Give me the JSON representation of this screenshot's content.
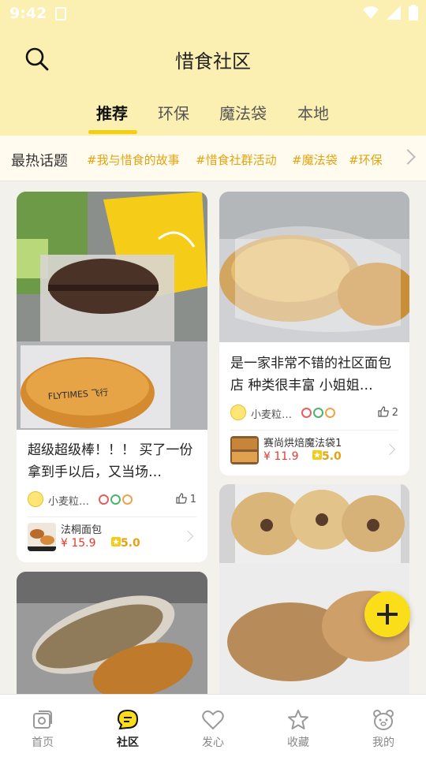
{
  "status_bar": {
    "time": "9:42"
  },
  "header": {
    "title": "惜食社区",
    "search_icon": "search-icon"
  },
  "tabs": [
    {
      "label": "推荐",
      "active": true
    },
    {
      "label": "环保",
      "active": false
    },
    {
      "label": "魔法袋",
      "active": false
    },
    {
      "label": "本地",
      "active": false
    }
  ],
  "hot_topics": {
    "label": "最热话题",
    "tags": [
      "#我与惜食的故事",
      "#惜食社群活动",
      "#魔法袋",
      "#环保"
    ]
  },
  "posts": [
    {
      "text": "超级超级棒！！！ 买了一份拿到手以后，又当场…",
      "user": "小麦粒…",
      "likes": "1",
      "product": {
        "name": "法桐面包",
        "price": "¥ 15.9",
        "rating": "5.0"
      }
    },
    {
      "text": "是一家非常不错的社区面包店 种类很丰富 小姐姐…",
      "user": "小麦粒…",
      "likes": "2",
      "product": {
        "name": "赛尚烘焙魔法袋1",
        "price": "¥ 11.9",
        "rating": "5.0"
      }
    }
  ],
  "photo_text": "FLYTIMES 飞行",
  "colors": {
    "accent": "#fbde1a",
    "header_bg": "#fbf0b2",
    "price": "#e7392e",
    "tag": "#e3a313"
  },
  "bottom_nav": [
    {
      "label": "首页",
      "icon": "home-icon",
      "active": false
    },
    {
      "label": "社区",
      "icon": "chat-icon",
      "active": true
    },
    {
      "label": "发心",
      "icon": "heart-icon",
      "active": false
    },
    {
      "label": "收藏",
      "icon": "star-icon",
      "active": false
    },
    {
      "label": "我的",
      "icon": "bear-face-icon",
      "active": false
    }
  ]
}
